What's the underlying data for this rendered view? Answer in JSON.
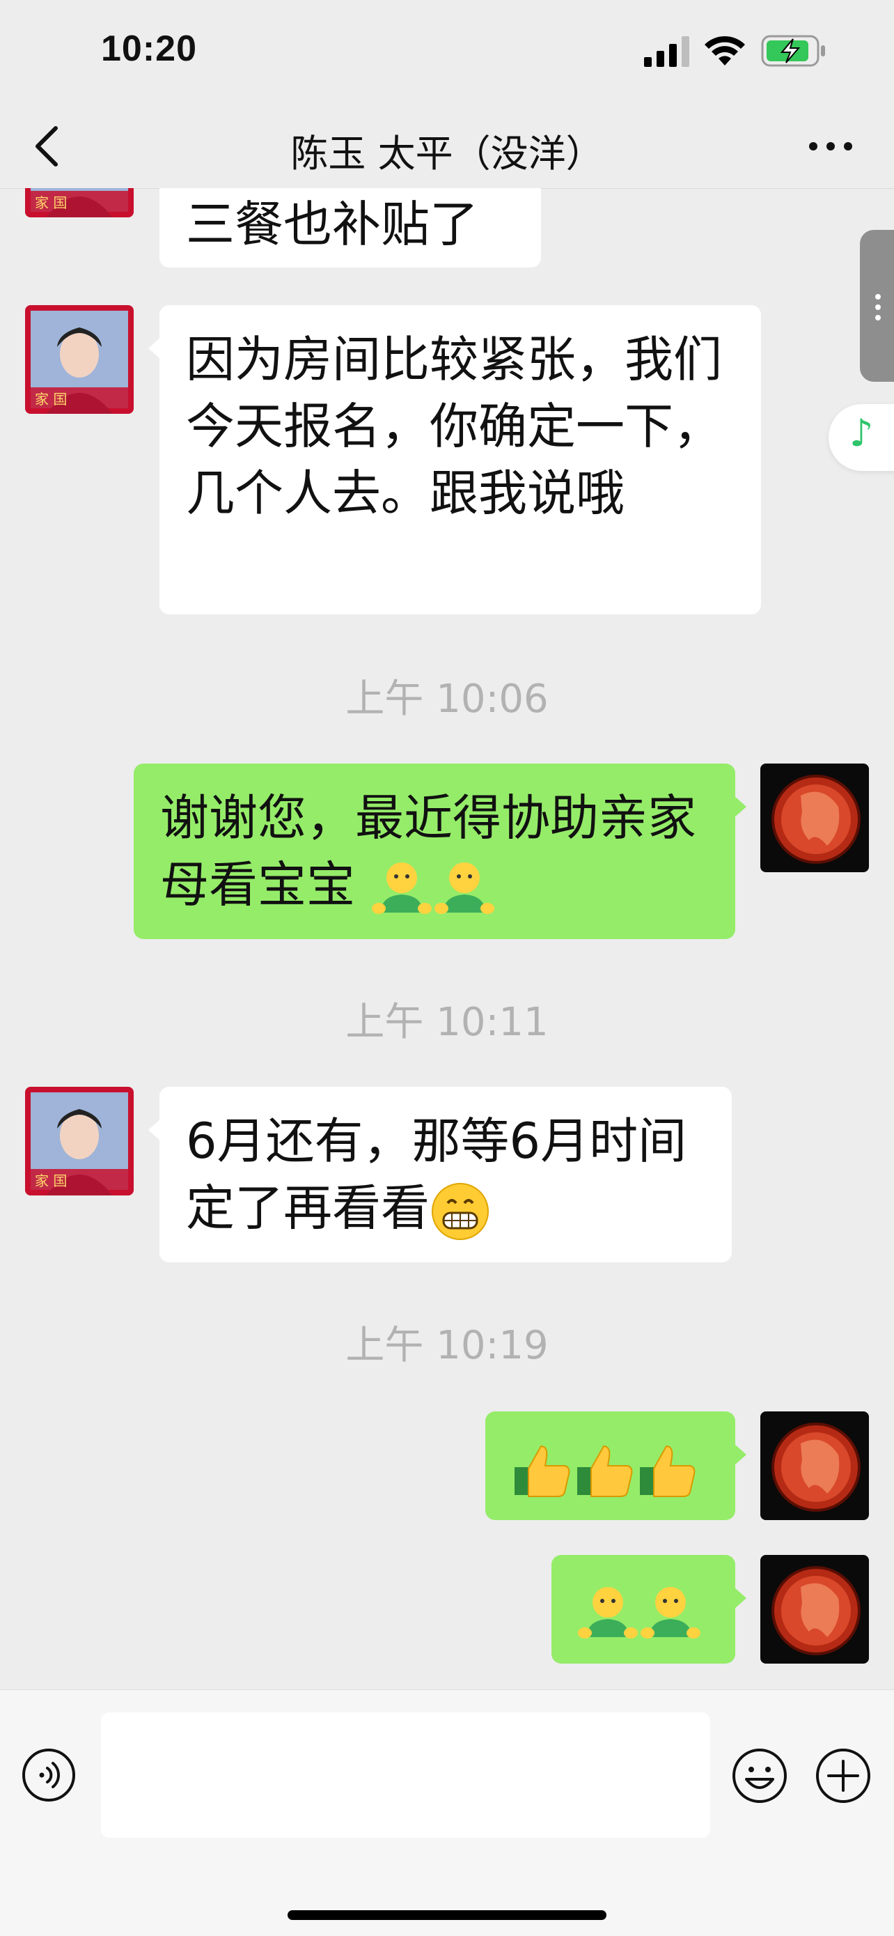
{
  "status_bar": {
    "time": "10:20"
  },
  "header": {
    "title": "陈玉 太平（没洋）"
  },
  "messages": [
    {
      "side": "in",
      "text": "三餐也补贴了"
    },
    {
      "side": "in",
      "text": "因为房间比较紧张，我们今天报名，你确定一下，几个人去。跟我说哦"
    },
    {
      "timestamp": "上午 10:06"
    },
    {
      "side": "out",
      "text": "谢谢您，最近得协助亲家母看宝宝 "
    },
    {
      "timestamp": "上午 10:11"
    },
    {
      "side": "in",
      "text": "6月还有，那等6月时间定了再看看"
    },
    {
      "timestamp": "上午 10:19"
    },
    {
      "side": "out",
      "emojis": [
        "thumbs-up",
        "thumbs-up",
        "thumbs-up"
      ]
    },
    {
      "side": "out",
      "emojis": [
        "green-figure",
        "green-figure"
      ]
    }
  ],
  "icons": {
    "back": "chevron-left-icon",
    "more": "more-dots-icon",
    "voice": "voice-icon",
    "emoji": "smiley-icon",
    "plus": "plus-icon",
    "side_tab": "drag-handle-icon",
    "music": "music-note-icon"
  },
  "colors": {
    "background": "#ededed",
    "outgoing_bubble": "#95ec69",
    "incoming_bubble": "#ffffff",
    "timestamp": "#b2b2b2"
  }
}
